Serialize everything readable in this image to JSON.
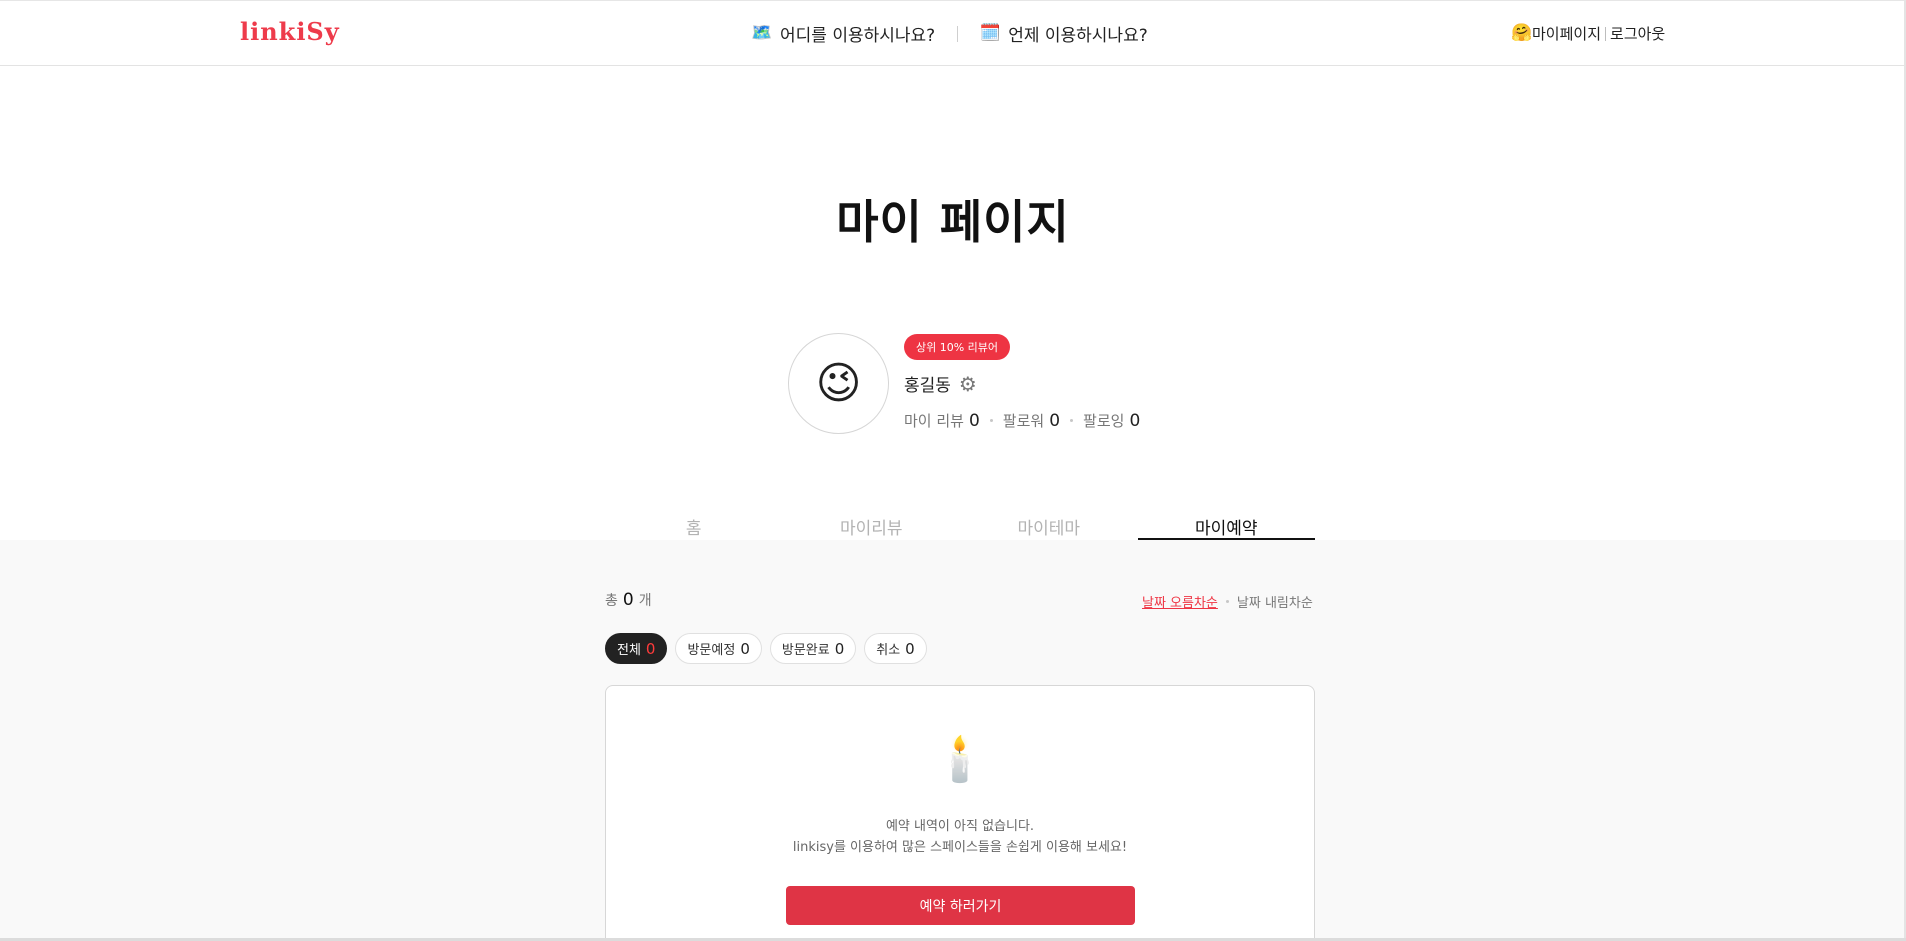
{
  "header": {
    "logo": "linkiSy",
    "nav_where": {
      "icon": "map-icon",
      "label": "어디를 이용하시나요?"
    },
    "nav_when": {
      "icon": "calendar-icon",
      "label": "언제 이용하시나요?"
    },
    "mypage_icon": "hugging-face-icon",
    "mypage_label": "마이페이지",
    "logout_label": "로그아웃"
  },
  "page": {
    "title": "마이 페이지"
  },
  "profile": {
    "avatar_emoji": "😉",
    "badge": "상위 10% 리뷰어",
    "name": "홍길동",
    "stats": [
      {
        "label": "마이 리뷰",
        "value": "0"
      },
      {
        "label": "팔로워",
        "value": "0"
      },
      {
        "label": "팔로잉",
        "value": "0"
      }
    ]
  },
  "tabs": [
    {
      "label": "홈",
      "active": false
    },
    {
      "label": "마이리뷰",
      "active": false
    },
    {
      "label": "마이테마",
      "active": false
    },
    {
      "label": "마이예약",
      "active": true
    }
  ],
  "content": {
    "total_prefix": "총",
    "total_count": "0",
    "total_suffix": "개",
    "sort_asc": "날짜 오름차순",
    "sort_desc": "날짜 내림차순",
    "filters": [
      {
        "label": "전체",
        "count": "0",
        "active": true
      },
      {
        "label": "방문예정",
        "count": "0",
        "active": false
      },
      {
        "label": "방문완료",
        "count": "0",
        "active": false
      },
      {
        "label": "취소",
        "count": "0",
        "active": false
      }
    ],
    "empty": {
      "icon": "candle-icon",
      "emoji": "🕯️",
      "line1": "예약 내역이 아직 없습니다.",
      "line2": "linkisy를 이용하여 많은 스페이스들을 손쉽게 이용해 보세요!",
      "button": "예약 하러가기"
    }
  },
  "colors": {
    "accent": "#ee3443",
    "button": "#df3445",
    "background_section": "#f9f9f9"
  }
}
